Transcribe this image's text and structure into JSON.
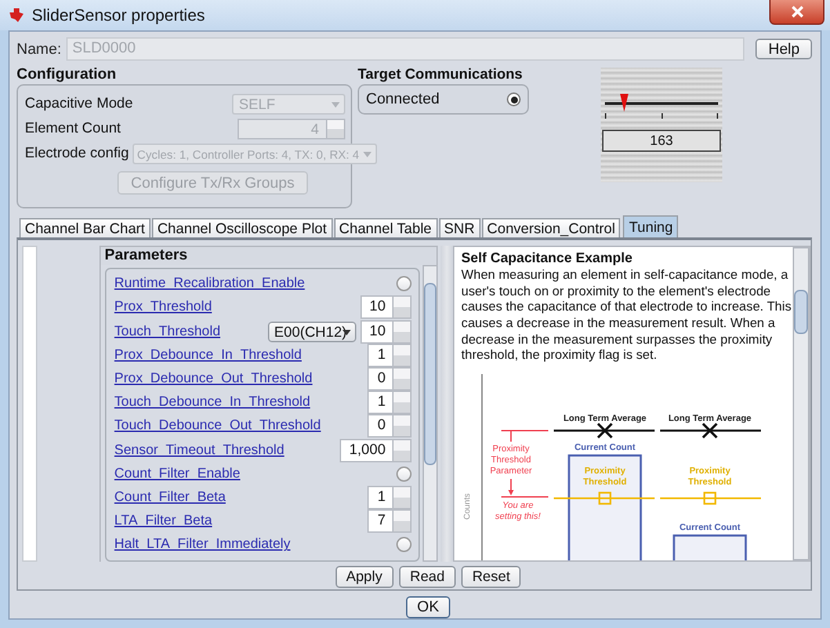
{
  "window": {
    "title": "SliderSensor properties"
  },
  "name": {
    "label": "Name:",
    "value": "SLD0000"
  },
  "help_button": "Help",
  "configuration": {
    "title": "Configuration",
    "fields": [
      {
        "label": "Capacitive Mode",
        "kind": "select",
        "value": "SELF",
        "disabled": true
      },
      {
        "label": "Element Count",
        "kind": "spin",
        "value": "4",
        "disabled": true
      },
      {
        "label": "Electrode config",
        "kind": "select",
        "value": "Cycles: 1, Controller Ports: 4, TX: 0, RX: 4",
        "disabled": true
      }
    ],
    "button": {
      "label": "Configure Tx/Rx Groups",
      "disabled": true
    }
  },
  "target_communications": {
    "title": "Target Communications",
    "label": "Connected",
    "on": true
  },
  "slider_display": {
    "level": 0.17,
    "reading": "163"
  },
  "tabs": [
    {
      "label": "Channel Bar Chart",
      "selected": false
    },
    {
      "label": "Channel Oscilloscope Plot",
      "selected": false
    },
    {
      "label": "Channel Table",
      "selected": false
    },
    {
      "label": "SNR",
      "selected": false
    },
    {
      "label": "Conversion_Control",
      "selected": false
    },
    {
      "label": "Tuning",
      "selected": true
    }
  ],
  "parameters": {
    "title": "Parameters",
    "rows": [
      {
        "label": "Runtime_Recalibration_Enable",
        "kind": "toggle",
        "on": false
      },
      {
        "label": "Prox_Threshold",
        "kind": "spin",
        "value": "10"
      },
      {
        "label": "Touch_Threshold",
        "kind": "spin_select",
        "select": "E00(CH12)",
        "value": "10"
      },
      {
        "label": "Prox_Debounce_In_Threshold",
        "kind": "spin",
        "value": "1"
      },
      {
        "label": "Prox_Debounce_Out_Threshold",
        "kind": "spin",
        "value": "0"
      },
      {
        "label": "Touch_Debounce_In_Threshold",
        "kind": "spin",
        "value": "1"
      },
      {
        "label": "Touch_Debounce_Out_Threshold",
        "kind": "spin",
        "value": "0"
      },
      {
        "label": "Sensor_Timeout_Threshold",
        "kind": "spin",
        "value": "1,000"
      },
      {
        "label": "Count_Filter_Enable",
        "kind": "toggle",
        "on": false
      },
      {
        "label": "Count_Filter_Beta",
        "kind": "spin",
        "value": "1"
      },
      {
        "label": "LTA_Filter_Beta",
        "kind": "spin",
        "value": "7"
      },
      {
        "label": "Halt_LTA_Filter_Immediately",
        "kind": "toggle",
        "on": false
      }
    ]
  },
  "help": {
    "title": "Self Capacitance Example",
    "text": "When measuring an element in self-capacitance mode, a user's touch on or proximity to the element's electrode causes the capacitance of that electrode to increase. This causes a decrease in the measurement result. When a decrease in the measurement surpasses the proximity threshold, the proximity flag is set.",
    "diagram": {
      "lta_labels": [
        "Long Term Average",
        "Long Term Average"
      ],
      "current_count_labels": [
        "Current Count",
        "Current Count"
      ],
      "threshold_labels": [
        [
          "Proximity",
          "Threshold"
        ],
        [
          "Proximity",
          "Threshold"
        ]
      ],
      "parameter_label": [
        "Proximity",
        "Threshold",
        "Parameter"
      ],
      "note": [
        "You are",
        "setting this!"
      ],
      "axis_label": "Counts"
    }
  },
  "buttons": [
    "Apply",
    "Read",
    "Reset"
  ],
  "ok_button": "OK"
}
